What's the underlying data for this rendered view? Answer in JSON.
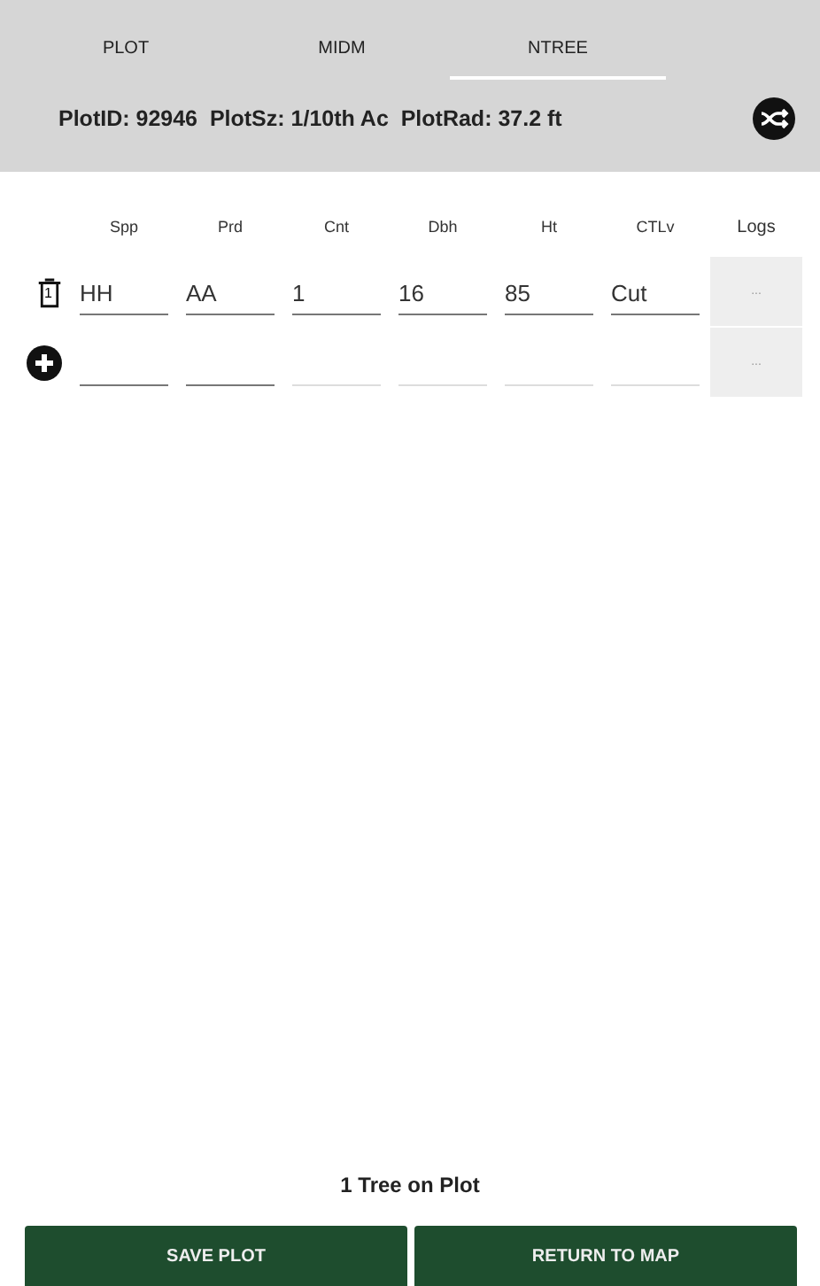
{
  "tabs": [
    {
      "label": "PLOT",
      "selected": false
    },
    {
      "label": "MIDM",
      "selected": false
    },
    {
      "label": "NTREE",
      "selected": true
    }
  ],
  "plot_info": "PlotID: 92946  PlotSz: 1/10th Ac  PlotRad: 37.2 ft",
  "table": {
    "columns": [
      "Spp",
      "Prd",
      "Cnt",
      "Dbh",
      "Ht",
      "CTLv",
      "Logs"
    ],
    "rows": [
      {
        "kind": "tree",
        "badge": "1",
        "values": [
          "HH",
          "AA",
          "1",
          "16",
          "85",
          "Cut"
        ],
        "logs": "..."
      },
      {
        "kind": "new",
        "values": [],
        "logs": "..."
      }
    ]
  },
  "summary": "1 Tree on Plot",
  "buttons": [
    "SAVE PLOT",
    "RETURN TO MAP"
  ]
}
